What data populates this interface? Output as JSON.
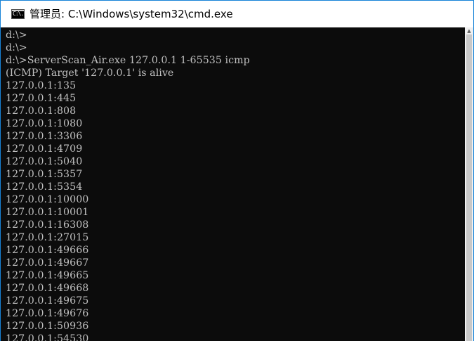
{
  "window": {
    "title": "管理员: C:\\Windows\\system32\\cmd.exe",
    "icon": "cmd-icon",
    "icon_glyph": "C:\\."
  },
  "colors": {
    "accent_border": "#1783d8",
    "console_bg": "#0c0c0c",
    "console_text": "#c0c0c0"
  },
  "console": {
    "lines": [
      "d:\\>",
      "d:\\>",
      "d:\\>ServerScan_Air.exe 127.0.0.1 1-65535 icmp",
      "(ICMP) Target '127.0.0.1' is alive",
      "127.0.0.1:135",
      "127.0.0.1:445",
      "127.0.0.1:808",
      "127.0.0.1:1080",
      "127.0.0.1:3306",
      "127.0.0.1:4709",
      "127.0.0.1:5040",
      "127.0.0.1:5357",
      "127.0.0.1:5354",
      "127.0.0.1:10000",
      "127.0.0.1:10001",
      "127.0.0.1:16308",
      "127.0.0.1:27015",
      "127.0.0.1:49666",
      "127.0.0.1:49667",
      "127.0.0.1:49665",
      "127.0.0.1:49668",
      "127.0.0.1:49675",
      "127.0.0.1:49676",
      "127.0.0.1:50936",
      "127.0.0.1:54530"
    ]
  }
}
